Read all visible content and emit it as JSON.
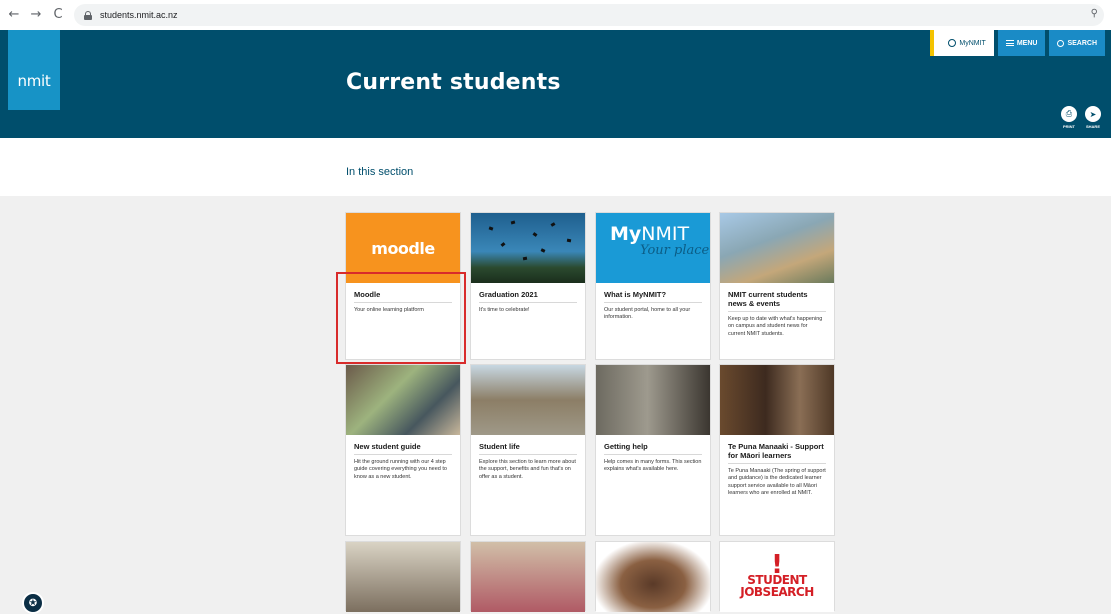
{
  "browser": {
    "url": "students.nmit.ac.nz",
    "back_glyph": "←",
    "forward_glyph": "→",
    "reload_glyph": "C",
    "zoom_glyph": "⚲"
  },
  "header": {
    "logo": "nmit",
    "title": "Current students",
    "mynmit_label": "MyNMIT",
    "menu_label": "MENU",
    "search_label": "SEARCH",
    "print_label": "PRINT",
    "share_label": "SHARE"
  },
  "section": {
    "title": "In this section"
  },
  "cards": [
    {
      "title": "Moodle",
      "desc": "Your online learning platform",
      "image": "moodle",
      "image_text": "moodle"
    },
    {
      "title": "Graduation 2021",
      "desc": "It's time to celebrate!",
      "image": "graduation"
    },
    {
      "title": "What is MyNMIT?",
      "desc": "Our student portal, home to all your information.",
      "image": "mynmit",
      "image_text_bold": "My",
      "image_text": "NMIT",
      "image_script": "Your place"
    },
    {
      "title": "NMIT current students news & events",
      "desc": "Keep up to date with what's happening on campus and student news for current NMIT students.",
      "image": "photo"
    },
    {
      "title": "New student guide",
      "desc": "Hit the ground running with our 4 step guide covering everything you need to know as a new student.",
      "image": "photo"
    },
    {
      "title": "Student life",
      "desc": "Explore this section to learn more about the support, benefits and fun that's on offer as a student.",
      "image": "photo"
    },
    {
      "title": "Getting help",
      "desc": "Help comes in many forms. This section explains what's available here.",
      "image": "photo"
    },
    {
      "title": "Te Puna Manaaki - Support for Māori learners",
      "desc": "Te Puna Manaaki (The spring of support and guidance) is the dedicated learner support service available to all Māori learners who are enrolled at NMIT.",
      "image": "photo"
    }
  ],
  "jobsearch": {
    "line1": "STUDENT",
    "line2": "JOBSEARCH"
  },
  "colors": {
    "header_bg": "#004e6c",
    "accent_blue": "#1a8bc6",
    "moodle_orange": "#f7931e",
    "highlight_red": "#d82b2b"
  }
}
